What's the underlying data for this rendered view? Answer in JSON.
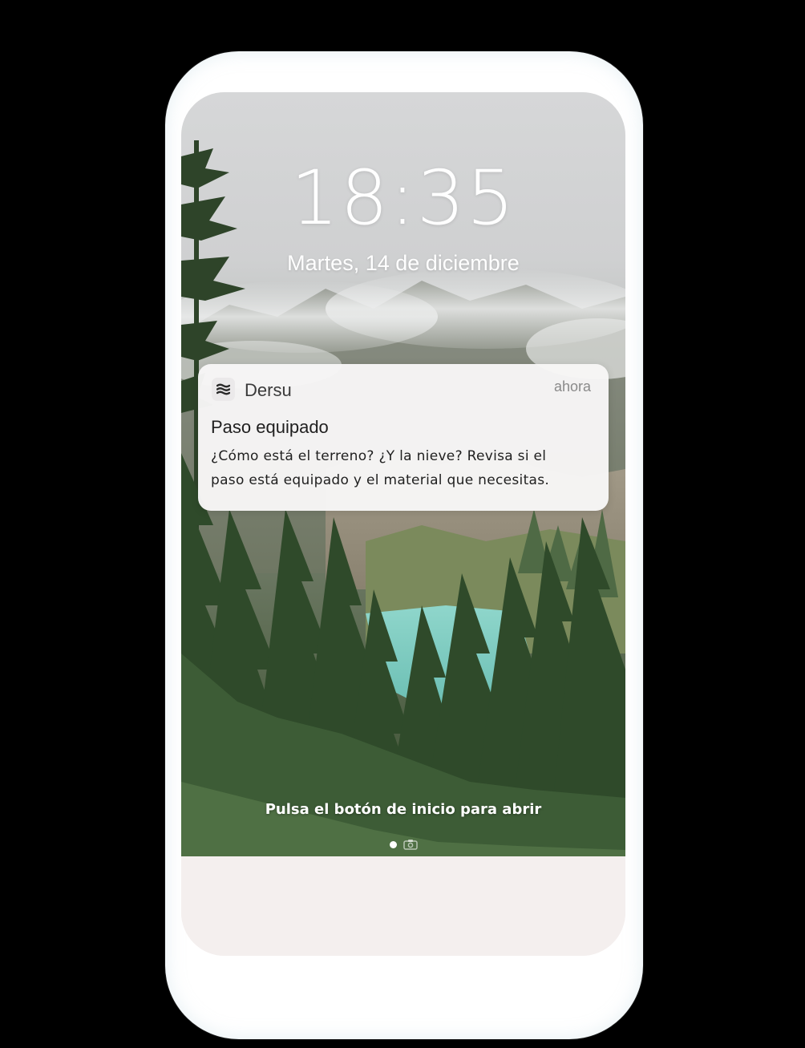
{
  "lockscreen": {
    "time": "18:35",
    "date": "Martes, 14 de diciembre",
    "unlock_hint": "Pulsa el botón de inicio para abrir"
  },
  "notification": {
    "app_name": "Dersu",
    "app_icon": "dersu-layers-icon",
    "time": "ahora",
    "title": "Paso equipado",
    "body_line1": "¿Cómo está el terreno? ¿Y la nieve? Revisa si el",
    "body_line2": "paso está equipado y el material que necesitas."
  },
  "page_indicator": {
    "active_page": 1,
    "extra_icon": "camera-icon"
  },
  "colors": {
    "background": "#000000",
    "frame": "#ffffff",
    "screen_bottom": "#f4efee",
    "notification_bg": "#f7f6f6",
    "lake": "#7fcfc4",
    "forest": "#2f4a2a"
  }
}
